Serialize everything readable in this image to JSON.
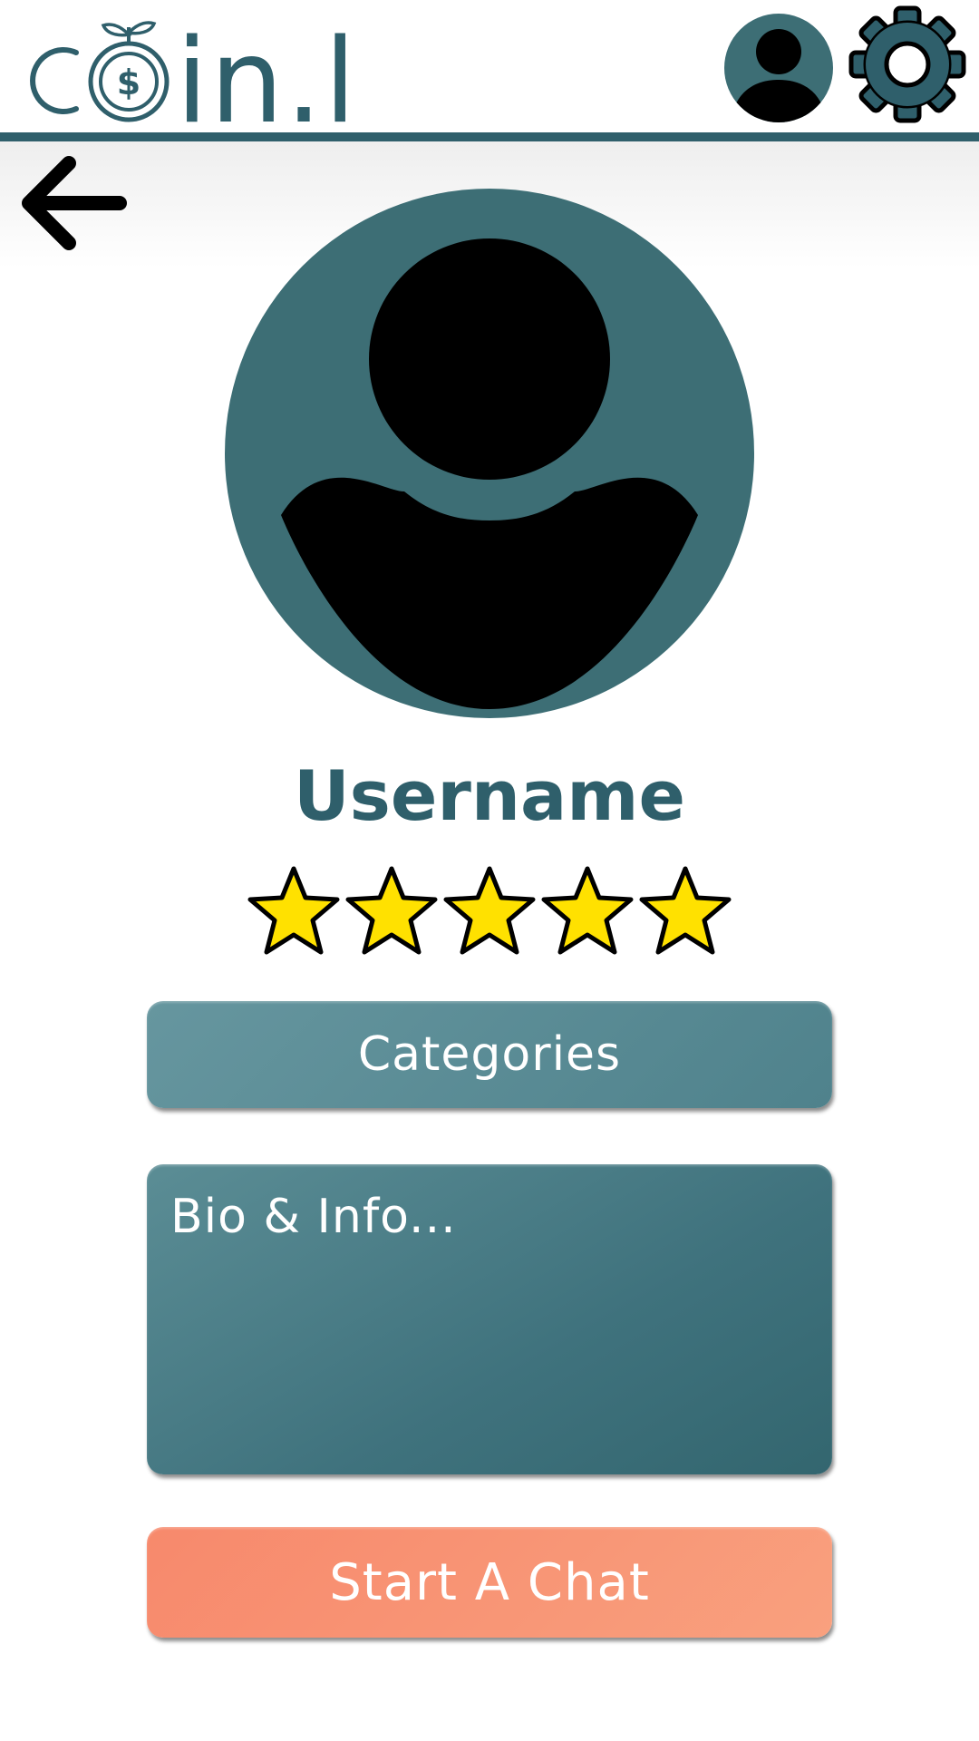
{
  "header": {
    "logo": {
      "text": "coin.li"
    },
    "account_icon": "person-circle-icon",
    "settings_icon": "gear-icon"
  },
  "nav": {
    "back_icon": "arrow-left-icon"
  },
  "profile": {
    "avatar_icon": "person-circle-icon",
    "username": "Username",
    "rating": {
      "value": 5,
      "max": 5
    },
    "categories_label": "Categories",
    "bio_placeholder": "Bio & Info...",
    "chat_button_label": "Start A Chat"
  },
  "colors": {
    "brand_teal": "#2f5f6b",
    "avatar_bg": "#3d6e75",
    "star_fill": "#ffe100",
    "chat_button": "#f9977a"
  }
}
